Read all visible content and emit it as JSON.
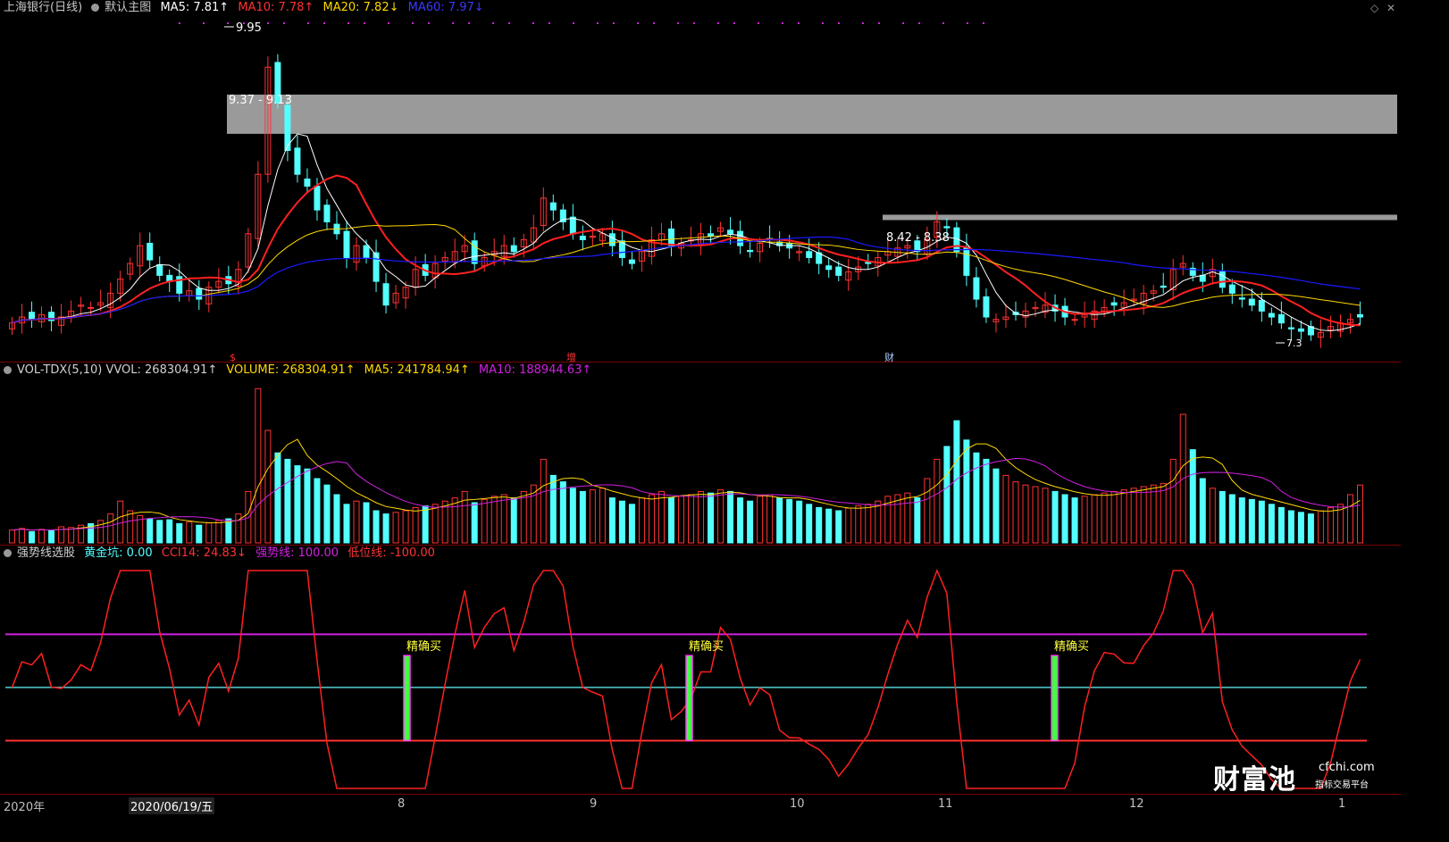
{
  "main_header": {
    "stock": "上海银行(日线)",
    "chart_name": "默认主图",
    "ma5": "MA5: 7.81↑",
    "ma10": "MA10: 7.78↑",
    "ma20": "MA20: 7.82↓",
    "ma60": "MA60: 7.97↓"
  },
  "price_labels": {
    "high": "9.95",
    "gap1": "9.37 - 9.13",
    "gap2": "8.42 - 8.38",
    "low": "7.3"
  },
  "markers": {
    "m1": "$",
    "m2": "增",
    "m3": "财"
  },
  "vol_header": {
    "name": "VOL-TDX(5,10) VVOL: 268304.91↑",
    "volume": "VOLUME: 268304.91↑",
    "ma5": "MA5: 241784.94↑",
    "ma10": "MA10: 188944.63↑"
  },
  "ind_header": {
    "name": "强势线选股",
    "golden_pit": "黄金坑: 0.00",
    "cci": "CCI14: 24.83↓",
    "strong": "强势线: 100.00",
    "low_line": "低位线: -100.00"
  },
  "buy_signal": "精确买",
  "axis": {
    "year": "2020年",
    "cursor_date": "2020/06/19/五",
    "months": [
      "8",
      "9",
      "10",
      "11",
      "12",
      "1"
    ]
  },
  "logo": {
    "brand": "财富池",
    "site": "cfchi.com",
    "tagline": "指标交易平台"
  },
  "colors": {
    "up": "#ff3232",
    "down": "#54ffff",
    "ma5": "#ffffff",
    "ma10": "#ff2020",
    "ma20": "#ffd700",
    "ma60": "#1a1aff",
    "purple": "#d020e0",
    "gap": "#9a9a9a"
  },
  "chart_data": {
    "type": "candlestick",
    "price_ylim": [
      7.2,
      10.0
    ],
    "closes": [
      7.45,
      7.5,
      7.48,
      7.52,
      7.47,
      7.5,
      7.55,
      7.6,
      7.58,
      7.62,
      7.7,
      7.82,
      7.95,
      8.1,
      7.98,
      7.85,
      7.8,
      7.7,
      7.72,
      7.65,
      7.75,
      7.8,
      7.78,
      7.9,
      8.2,
      8.7,
      9.6,
      9.3,
      8.9,
      8.7,
      8.6,
      8.4,
      8.3,
      8.2,
      8.0,
      8.1,
      8.0,
      7.8,
      7.6,
      7.7,
      7.75,
      7.9,
      7.85,
      7.95,
      8.0,
      8.05,
      8.1,
      7.95,
      8.0,
      8.05,
      8.1,
      8.05,
      8.15,
      8.25,
      8.5,
      8.4,
      8.3,
      8.2,
      8.15,
      8.18,
      8.2,
      8.1,
      8.0,
      7.95,
      8.05,
      8.15,
      8.2,
      8.1,
      8.12,
      8.15,
      8.2,
      8.18,
      8.25,
      8.2,
      8.1,
      8.05,
      8.12,
      8.15,
      8.1,
      8.08,
      8.05,
      8.0,
      7.95,
      7.9,
      7.85,
      7.88,
      7.92,
      7.95,
      8.0,
      8.05,
      8.08,
      8.1,
      8.05,
      8.15,
      8.3,
      8.25,
      8.05,
      7.85,
      7.65,
      7.5,
      7.48,
      7.5,
      7.52,
      7.55,
      7.58,
      7.6,
      7.55,
      7.5,
      7.48,
      7.52,
      7.55,
      7.58,
      7.6,
      7.62,
      7.65,
      7.7,
      7.72,
      7.75,
      7.9,
      7.95,
      7.85,
      7.8,
      7.9,
      7.75,
      7.7,
      7.65,
      7.6,
      7.55,
      7.5,
      7.45,
      7.4,
      7.38,
      7.35,
      7.37,
      7.42,
      7.45,
      7.48,
      7.5
    ],
    "volume_ylim": [
      0,
      500000
    ],
    "volumes": [
      40,
      45,
      35,
      42,
      38,
      50,
      48,
      55,
      60,
      70,
      90,
      130,
      100,
      85,
      75,
      70,
      72,
      60,
      65,
      55,
      62,
      70,
      75,
      90,
      160,
      480,
      350,
      280,
      260,
      240,
      230,
      200,
      180,
      150,
      120,
      130,
      125,
      100,
      90,
      95,
      100,
      110,
      115,
      120,
      130,
      140,
      160,
      125,
      135,
      145,
      150,
      140,
      160,
      180,
      260,
      210,
      190,
      170,
      160,
      165,
      170,
      140,
      130,
      120,
      140,
      150,
      160,
      140,
      145,
      150,
      160,
      155,
      165,
      160,
      140,
      130,
      145,
      150,
      140,
      135,
      130,
      120,
      110,
      105,
      100,
      108,
      115,
      120,
      130,
      145,
      150,
      155,
      140,
      200,
      260,
      300,
      380,
      320,
      280,
      260,
      230,
      210,
      190,
      180,
      175,
      170,
      160,
      150,
      140,
      145,
      150,
      155,
      160,
      165,
      170,
      175,
      180,
      185,
      260,
      400,
      290,
      200,
      170,
      160,
      150,
      140,
      135,
      130,
      120,
      110,
      100,
      95,
      90,
      100,
      110,
      120,
      150,
      180
    ],
    "cci_ylim": [
      -200,
      230
    ]
  }
}
